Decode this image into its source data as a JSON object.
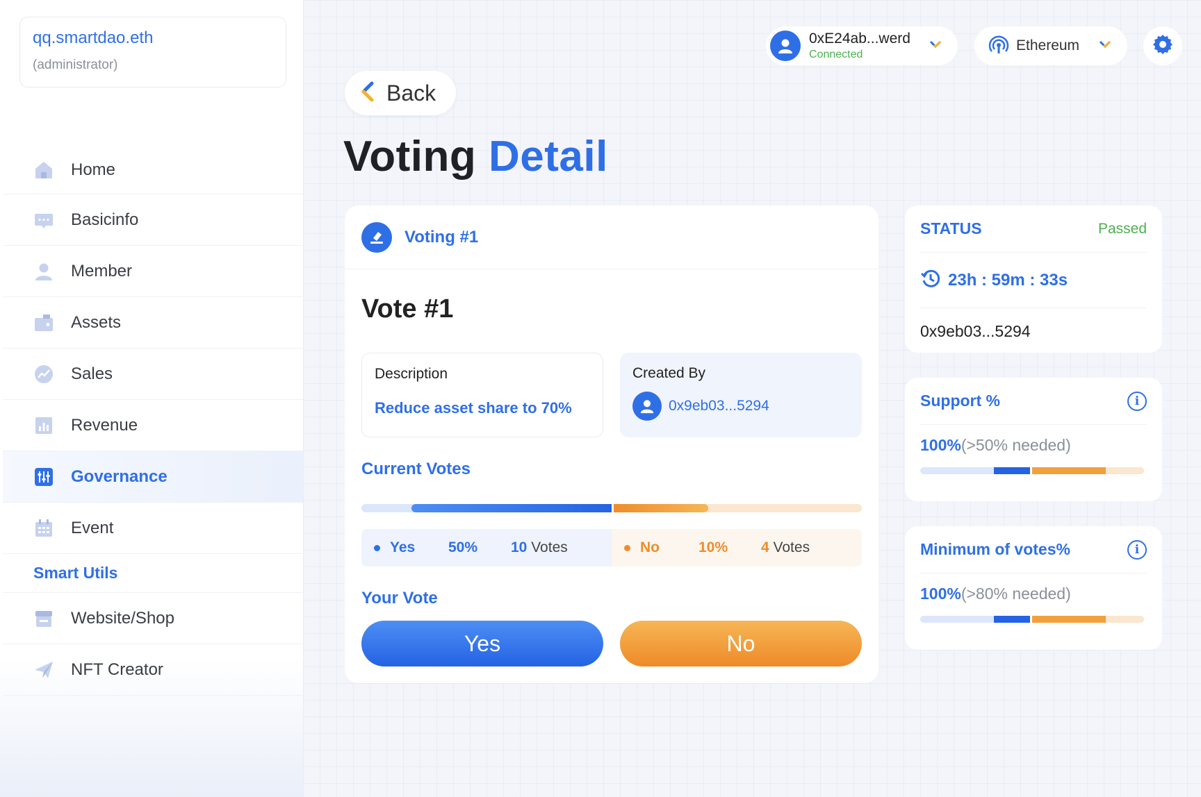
{
  "account": {
    "name": "qq.smartdao.eth",
    "role": "(administrator)"
  },
  "sidebar": {
    "items": [
      {
        "label": "Home",
        "icon": "home-icon"
      },
      {
        "label": "Basicinfo",
        "icon": "chat-icon"
      },
      {
        "label": "Member",
        "icon": "user-icon"
      },
      {
        "label": "Assets",
        "icon": "wallet-icon"
      },
      {
        "label": "Sales",
        "icon": "trend-icon"
      },
      {
        "label": "Revenue",
        "icon": "chart-icon"
      },
      {
        "label": "Governance",
        "icon": "sliders-icon",
        "active": true
      },
      {
        "label": "Event",
        "icon": "calendar-icon"
      }
    ],
    "section_title": "Smart Utils",
    "utils": [
      {
        "label": "Website/Shop",
        "icon": "store-icon"
      },
      {
        "label": "NFT Creator",
        "icon": "send-icon"
      }
    ]
  },
  "topbar": {
    "wallet_address": "0xE24ab...werd",
    "wallet_status": "Connected",
    "network": "Ethereum"
  },
  "back_label": "Back",
  "title": {
    "part1": "Voting",
    "part2": "Detail"
  },
  "voting": {
    "header": "Voting #1",
    "vote_title": "Vote #1",
    "description_label": "Description",
    "description": "Reduce asset share to 70%",
    "created_by_label": "Created By",
    "created_by": "0x9eb03...5294",
    "current_votes_label": "Current Votes",
    "yes": {
      "label": "Yes",
      "pct": "50%",
      "count": "10",
      "votes_word": "Votes"
    },
    "no": {
      "label": "No",
      "pct": "10%",
      "count": "4",
      "votes_word": "Votes"
    },
    "yes_fraction": 0.5,
    "no_fraction": 0.1,
    "your_vote_label": "Your Vote",
    "yes_button": "Yes",
    "no_button": "No"
  },
  "status_card": {
    "title": "STATUS",
    "value": "Passed",
    "timer": "23h : 59m : 33s",
    "address": "0x9eb03...5294"
  },
  "support_card": {
    "title": "Support %",
    "value": "100%",
    "note": "(>50% needed)"
  },
  "minimum_card": {
    "title": "Minimum of votes%",
    "value": "100%",
    "note": "(>80% needed)"
  },
  "colors": {
    "accent": "#2f6fe6",
    "orange": "#ef8c2a",
    "success": "#4cb050"
  }
}
